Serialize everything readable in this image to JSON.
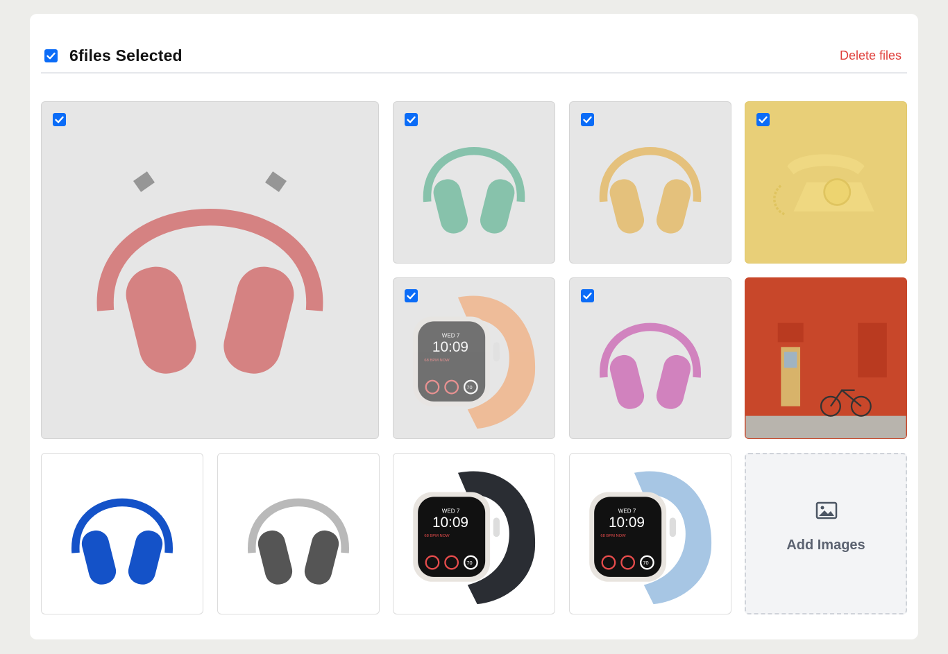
{
  "header": {
    "title": "6files Selected",
    "delete_label": "Delete files"
  },
  "gallery": {
    "items": [
      {
        "name": "red-headphones",
        "icon": "headphones-image",
        "color": "#c83232",
        "selected": true
      },
      {
        "name": "green-headphones",
        "icon": "headphones-image",
        "color": "#3aa57c",
        "selected": true
      },
      {
        "name": "yellow-headphones",
        "icon": "headphones-image",
        "color": "#e3a326",
        "selected": true
      },
      {
        "name": "rotary-telephone",
        "icon": "telephone-image",
        "color": "#f2cf4a",
        "selected": true
      },
      {
        "name": "orange-watch",
        "icon": "smartwatch-image",
        "color": "#f59a5a",
        "selected": true
      },
      {
        "name": "magenta-headphones",
        "icon": "headphones-image",
        "color": "#c0329f",
        "selected": true
      },
      {
        "name": "red-brick-wall",
        "icon": "building-photo",
        "color": "#c8472a",
        "selected": false
      },
      {
        "name": "blue-headphones",
        "icon": "headphones-image",
        "color": "#1452c8",
        "selected": false
      },
      {
        "name": "silver-headphones",
        "icon": "headphones-image",
        "color": "#b9b9b9",
        "selected": false
      },
      {
        "name": "black-watch",
        "icon": "smartwatch-image",
        "color": "#2a2d33",
        "selected": false
      },
      {
        "name": "blue-watch",
        "icon": "smartwatch-image",
        "color": "#a7c6e4",
        "selected": false
      }
    ],
    "watch_face": {
      "day": "WED 7",
      "time": "10:09",
      "metric": "68 BPM NOW",
      "number": "70"
    }
  },
  "add_images": {
    "label": "Add Images",
    "icon": "image-icon"
  },
  "colors": {
    "accent": "#0b6cf7",
    "danger": "#e0403c"
  }
}
